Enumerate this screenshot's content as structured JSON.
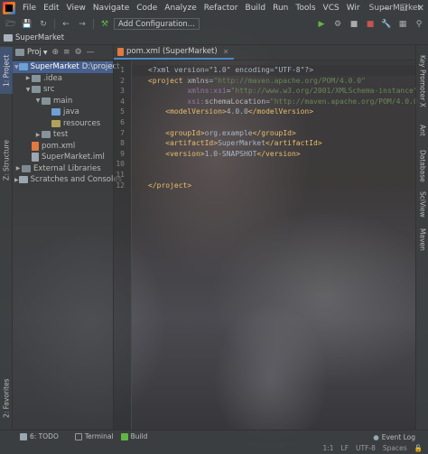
{
  "menubar": {
    "items": [
      "File",
      "Edit",
      "View",
      "Navigate",
      "Code",
      "Analyze",
      "Refactor",
      "Build",
      "Run",
      "Tools",
      "VCS",
      "Wir"
    ],
    "title": "SuperMarket",
    "controls": [
      "minimize",
      "maximize",
      "close"
    ]
  },
  "toolbar": {
    "run_config": "Add Configuration..."
  },
  "breadcrumb": {
    "project": "SuperMarket"
  },
  "left_tool_tabs": {
    "project": "1: Project",
    "structure": "Z: Structure",
    "favorites": "2: Favorites"
  },
  "right_tool_tabs": {
    "key_promoter": "Key Promoter X",
    "ant": "Ant",
    "database": "Database",
    "sciview": "SciView",
    "maven": "Maven"
  },
  "project_panel": {
    "selector": "Proj",
    "tree": [
      {
        "label": "SuperMarket",
        "extra": "D:\\project",
        "type": "module",
        "depth": 0,
        "expanded": true,
        "selected": true
      },
      {
        "label": ".idea",
        "type": "folder",
        "depth": 1,
        "expanded": false
      },
      {
        "label": "src",
        "type": "folder",
        "depth": 1,
        "expanded": true
      },
      {
        "label": "main",
        "type": "folder",
        "depth": 2,
        "expanded": true
      },
      {
        "label": "java",
        "type": "folder-src",
        "depth": 3
      },
      {
        "label": "resources",
        "type": "folder-res",
        "depth": 3
      },
      {
        "label": "test",
        "type": "folder",
        "depth": 2,
        "expanded": false
      },
      {
        "label": "pom.xml",
        "type": "file-xml",
        "depth": 1
      },
      {
        "label": "SuperMarket.iml",
        "type": "file-iml",
        "depth": 1
      },
      {
        "label": "External Libraries",
        "type": "lib",
        "depth": 0,
        "expanded": false
      },
      {
        "label": "Scratches and Consoles",
        "type": "scratch",
        "depth": 0,
        "expanded": false
      }
    ]
  },
  "editor": {
    "tab_label": "pom.xml (SuperMarket)",
    "line_numbers": [
      "1",
      "2",
      "3",
      "4",
      "5",
      "6",
      "7",
      "8",
      "9",
      "10",
      "11",
      "12"
    ],
    "lines": [
      [
        [
          "t-txt",
          "<?xml version=\"1.0\" encoding=\"UTF-8\"?>"
        ]
      ],
      [
        [
          "t-tag",
          "<project "
        ],
        [
          "t-attr",
          "xmlns"
        ],
        [
          "t-txt",
          "="
        ],
        [
          "t-str",
          "\"http://maven.apache.org/POM/4.0.0\""
        ]
      ],
      [
        [
          "t-txt",
          "         "
        ],
        [
          "t-ns",
          "xmlns:xsi"
        ],
        [
          "t-txt",
          "="
        ],
        [
          "t-str",
          "\"http://www.w3.org/2001/XMLSchema-instance\""
        ]
      ],
      [
        [
          "t-txt",
          "         "
        ],
        [
          "t-ns",
          "xsi:"
        ],
        [
          "t-attr",
          "schemaLocation"
        ],
        [
          "t-txt",
          "="
        ],
        [
          "t-str",
          "\"http://maven.apache.org/POM/4.0.0"
        ]
      ],
      [
        [
          "t-txt",
          "    "
        ],
        [
          "t-tag",
          "<modelVersion>"
        ],
        [
          "t-txt",
          "4.0.0"
        ],
        [
          "t-tag",
          "</modelVersion>"
        ]
      ],
      [],
      [
        [
          "t-txt",
          "    "
        ],
        [
          "t-tag",
          "<groupId>"
        ],
        [
          "t-txt",
          "org.example"
        ],
        [
          "t-tag",
          "</groupId>"
        ]
      ],
      [
        [
          "t-txt",
          "    "
        ],
        [
          "t-tag",
          "<artifactId>"
        ],
        [
          "t-txt",
          "SuperMarket"
        ],
        [
          "t-tag",
          "</artifactId>"
        ]
      ],
      [
        [
          "t-txt",
          "    "
        ],
        [
          "t-tag",
          "<version>"
        ],
        [
          "t-txt",
          "1.0-SNAPSHOT"
        ],
        [
          "t-tag",
          "</version>"
        ]
      ],
      [],
      [],
      [
        [
          "t-tag",
          "</project>"
        ]
      ]
    ]
  },
  "bottom_tools": {
    "todo": "6: TODO",
    "terminal": "Terminal",
    "build": "Build",
    "event_log": "Event Log"
  },
  "statusbar": {
    "position": "1:1",
    "line_sep": "LF",
    "encoding": "UTF-8",
    "extra": "Spaces"
  },
  "colors": {
    "selection": "#4b6eaf",
    "tag": "#e8bf6a",
    "string": "#6a8759",
    "namespace": "#9876aa"
  }
}
